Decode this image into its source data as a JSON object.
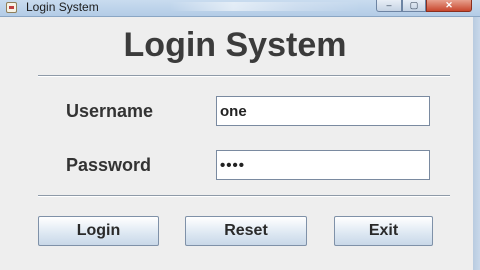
{
  "window": {
    "title": "Login System",
    "controls": {
      "minimize": "–",
      "maximize": "▢",
      "close": "✕"
    }
  },
  "form": {
    "heading": "Login System",
    "username_label": "Username",
    "username_value": "one",
    "password_label": "Password",
    "password_value": "1234"
  },
  "buttons": {
    "login": "Login",
    "reset": "Reset",
    "exit": "Exit"
  }
}
